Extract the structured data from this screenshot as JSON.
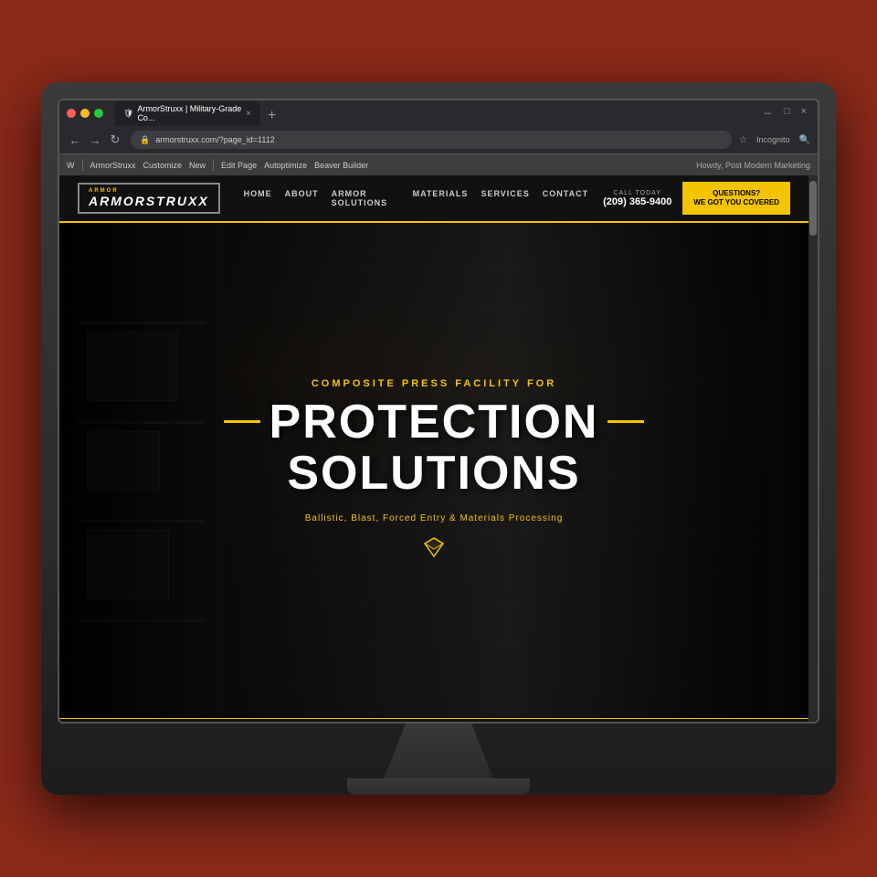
{
  "desktop": {
    "bg_color": "#8B2A1A"
  },
  "browser": {
    "tab_title": "ArmorStruxx | Military-Grade Co...",
    "tab_new_label": "+",
    "address": "armorstruxx.com/?page_id=1112",
    "incognito_label": "Incognito",
    "toolbar_items": [
      "ArmorStruxx",
      "Customize",
      "New",
      "Edit Page",
      "Autoptimize",
      "Beaver Builder"
    ],
    "search_icon": "🔍",
    "back_label": "←",
    "forward_label": "→",
    "refresh_label": "↻"
  },
  "website": {
    "logo_line1": "ArmorStruxx",
    "logo_line2": "ARMORSTRUXX",
    "nav_links": [
      "HOME",
      "ABOUT",
      "ARMOR SOLUTIONS",
      "MATERIALS",
      "SERVICES",
      "CONTACT"
    ],
    "call_label": "CALL TODAY",
    "call_number": "(209) 365-9400",
    "cta_line1": "QUESTIONS?",
    "cta_line2": "WE GOT YOU COVERED",
    "hero_tagline": "COMPOSITE PRESS FACILITY FOR",
    "hero_title_line1": "PROTECTION",
    "hero_title_line2": "SOLUTIONS",
    "hero_desc": "Ballistic, Blast, Forced Entry & Materials Processing",
    "hero_diamond": "◇"
  }
}
